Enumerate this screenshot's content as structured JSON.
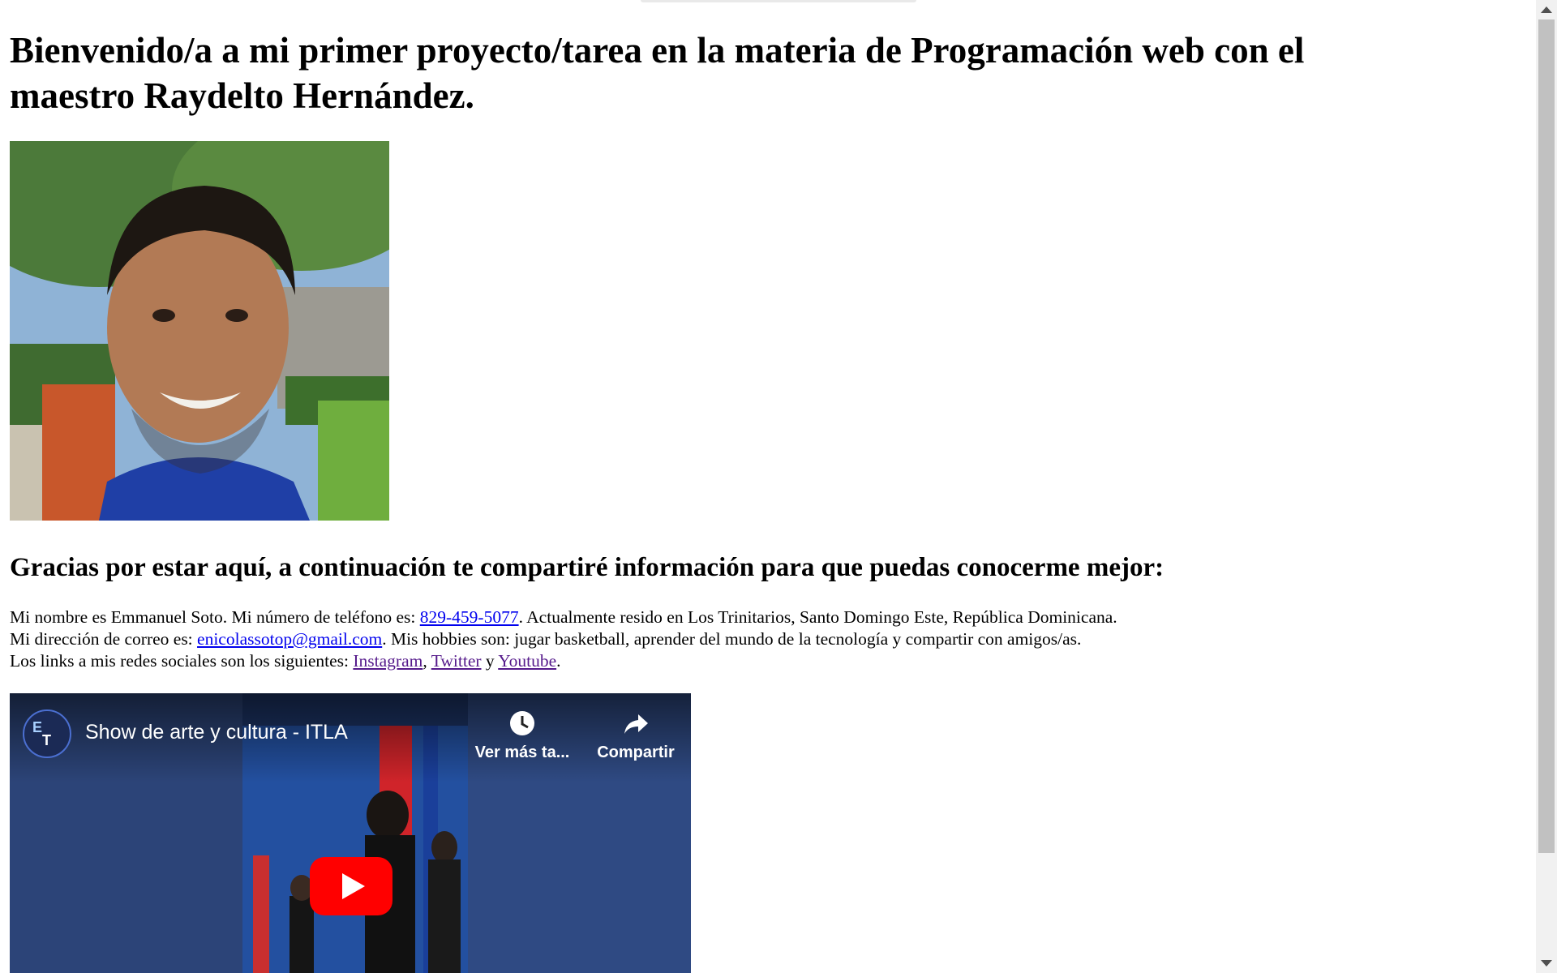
{
  "heading": "Bienvenido/a a mi primer proyecto/tarea en la materia de Programación web con el maestro Raydelto Hernández.",
  "photo_alt": "Foto de Emmanuel Soto",
  "subheading": "Gracias por estar aquí, a continuación te compartiré información para que puedas conocerme mejor:",
  "info": {
    "line1_pre": "Mi nombre es Emmanuel Soto. Mi número de teléfono es: ",
    "phone": "829-459-5077",
    "line1_post": ". Actualmente resido en Los Trinitarios, Santo Domingo Este, República Dominicana.",
    "line2_pre": "Mi dirección de correo es: ",
    "email": "enicolassotop@gmail.com",
    "line2_post": ". Mis hobbies son: jugar basketball, aprender del mundo de la tecnología y compartir con amigos/as.",
    "line3_pre": "Los links a mis redes sociales son los siguientes: ",
    "social": [
      "Instagram",
      "Twitter",
      "Youtube"
    ],
    "sep_comma": ", ",
    "sep_y": " y ",
    "line3_post": "."
  },
  "video": {
    "title": "Show de arte y cultura - ITLA",
    "watch_later": "Ver más ta...",
    "share": "Compartir",
    "channel_logo": "ET-tech-logo",
    "accent_red": "#ff0000"
  },
  "colors": {
    "link": "#0000ee",
    "visited_link": "#551a8b"
  }
}
